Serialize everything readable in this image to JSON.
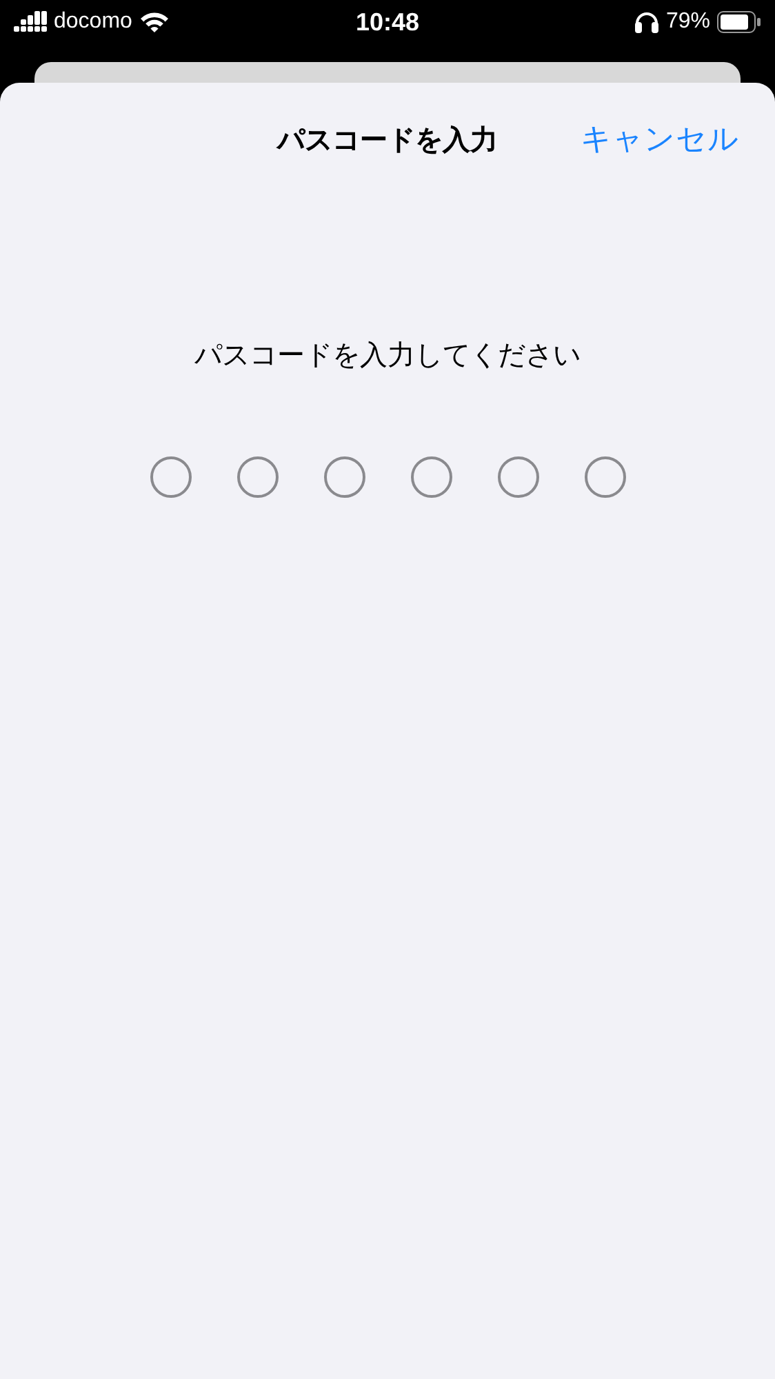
{
  "status_bar": {
    "carrier": "docomo",
    "time": "10:48",
    "battery": "79%"
  },
  "sheet": {
    "title": "パスコードを入力",
    "cancel": "キャンセル",
    "prompt": "パスコードを入力してください",
    "digits": [
      {
        "filled": false
      },
      {
        "filled": false
      },
      {
        "filled": false
      },
      {
        "filled": false
      },
      {
        "filled": false
      },
      {
        "filled": false
      }
    ]
  }
}
